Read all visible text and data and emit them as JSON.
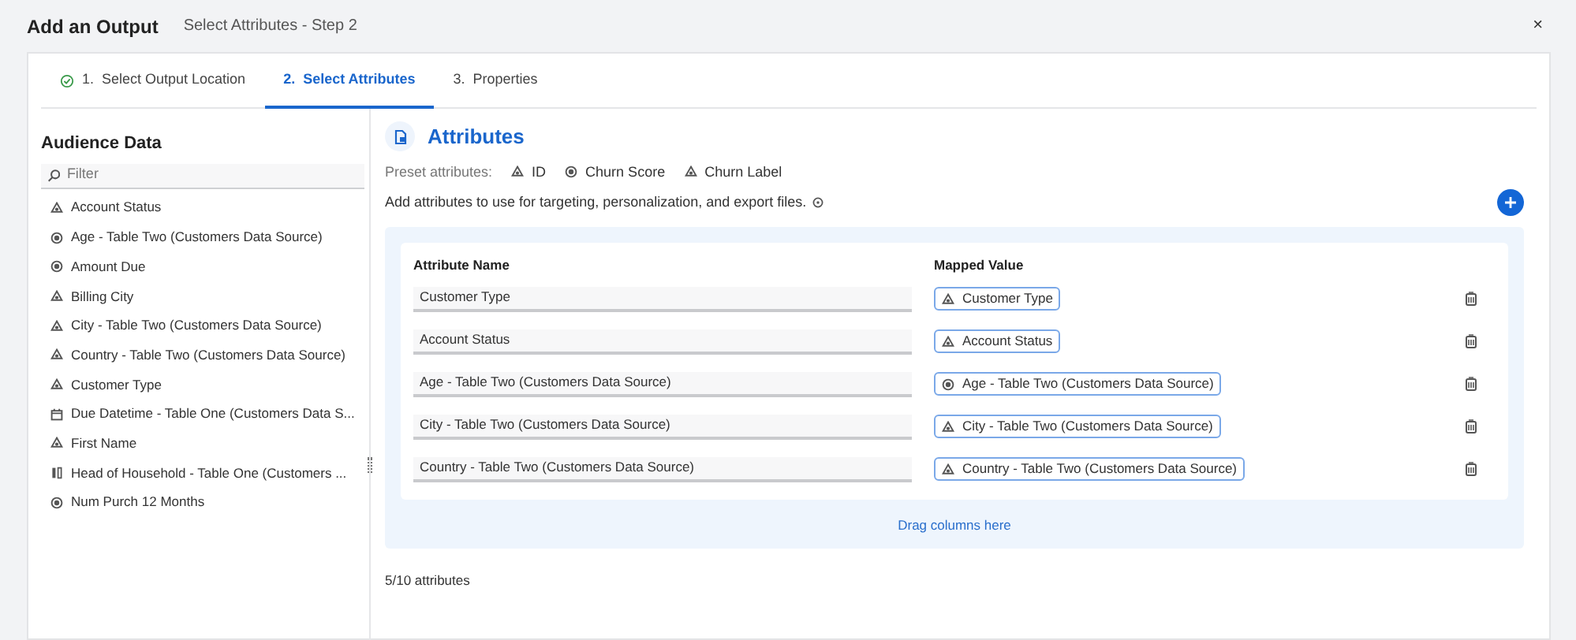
{
  "header": {
    "title": "Add an Output",
    "subtitle": "Select Attributes - Step 2",
    "close": "×"
  },
  "tabs": [
    {
      "label": "1.  Select Output Location",
      "completed": true,
      "selected": false
    },
    {
      "label": "2.  Select Attributes",
      "completed": false,
      "selected": true
    },
    {
      "label": "3.  Properties",
      "completed": false,
      "selected": false
    }
  ],
  "sidebar": {
    "title": "Audience Data",
    "search": {
      "placeholder": "Filter"
    },
    "items": [
      {
        "kind": "text",
        "label": "Account Status"
      },
      {
        "kind": "number",
        "label": "Age - Table Two (Customers Data Source)"
      },
      {
        "kind": "number",
        "label": "Amount Due"
      },
      {
        "kind": "text",
        "label": "Billing City"
      },
      {
        "kind": "text",
        "label": "City - Table Two (Customers Data Source)"
      },
      {
        "kind": "text",
        "label": "Country - Table Two (Customers Data Source)"
      },
      {
        "kind": "text",
        "label": "Customer Type"
      },
      {
        "kind": "date",
        "label": "Due Datetime - Table One (Customers Data S..."
      },
      {
        "kind": "text",
        "label": "First Name"
      },
      {
        "kind": "boolean",
        "label": "Head of Household - Table One (Customers ..."
      },
      {
        "kind": "number",
        "label": "Num Purch 12 Months"
      }
    ]
  },
  "main": {
    "title": "Attributes",
    "preset_label": "Preset attributes:",
    "presets": [
      {
        "kind": "text",
        "label": "ID"
      },
      {
        "kind": "number",
        "label": "Churn Score"
      },
      {
        "kind": "text",
        "label": "Churn Label"
      }
    ],
    "description": "Add attributes to use for targeting, personalization, and export files.",
    "table": {
      "columns": [
        "Attribute Name",
        "Mapped Value"
      ],
      "rows": [
        {
          "name": "Customer Type",
          "mapped": {
            "kind": "text",
            "label": "Customer Type"
          }
        },
        {
          "name": "Account Status",
          "mapped": {
            "kind": "text",
            "label": "Account Status"
          }
        },
        {
          "name": "Age - Table Two (Customers Data Source)",
          "mapped": {
            "kind": "number",
            "label": "Age - Table Two (Customers Data Source)"
          }
        },
        {
          "name": "City - Table Two (Customers Data Source)",
          "mapped": {
            "kind": "text",
            "label": "City - Table Two (Customers Data Source)"
          }
        },
        {
          "name": "Country - Table Two (Customers Data Source)",
          "mapped": {
            "kind": "text",
            "label": "Country - Table Two (Customers Data Source)"
          }
        }
      ]
    },
    "drop_hint": "Drag columns here",
    "count": "5/10 attributes"
  }
}
